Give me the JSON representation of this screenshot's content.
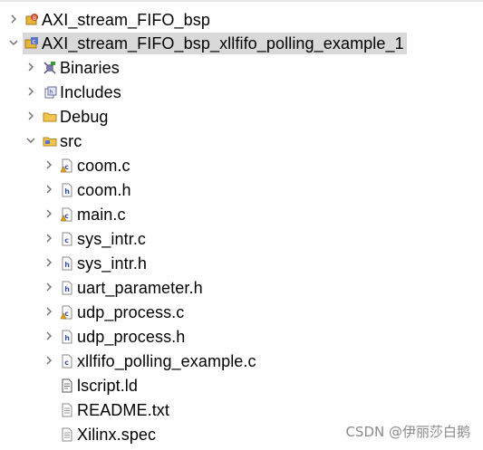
{
  "project_explorer": {
    "nodes": [
      {
        "label": "AXI_stream_FIFO_bsp",
        "icon": "bsp-project-icon",
        "expanded": false,
        "depth": 0,
        "selected": false
      },
      {
        "label": "AXI_stream_FIFO_bsp_xllfifo_polling_example_1",
        "icon": "c-project-icon",
        "expanded": true,
        "depth": 0,
        "selected": true
      },
      {
        "label": "Binaries",
        "icon": "binaries-icon",
        "expanded": false,
        "depth": 1,
        "selected": false
      },
      {
        "label": "Includes",
        "icon": "includes-icon",
        "expanded": false,
        "depth": 1,
        "selected": false
      },
      {
        "label": "Debug",
        "icon": "folder-icon",
        "expanded": false,
        "depth": 1,
        "selected": false
      },
      {
        "label": "src",
        "icon": "source-folder-icon",
        "expanded": true,
        "depth": 1,
        "selected": false
      },
      {
        "label": "coom.c",
        "icon": "c-file-warning-icon",
        "expanded": false,
        "depth": 2,
        "selected": false
      },
      {
        "label": "coom.h",
        "icon": "h-file-icon",
        "expanded": false,
        "depth": 2,
        "selected": false
      },
      {
        "label": "main.c",
        "icon": "c-file-warning-icon",
        "expanded": false,
        "depth": 2,
        "selected": false
      },
      {
        "label": "sys_intr.c",
        "icon": "c-file-icon",
        "expanded": false,
        "depth": 2,
        "selected": false
      },
      {
        "label": "sys_intr.h",
        "icon": "h-file-icon",
        "expanded": false,
        "depth": 2,
        "selected": false
      },
      {
        "label": "uart_parameter.h",
        "icon": "h-file-icon",
        "expanded": false,
        "depth": 2,
        "selected": false
      },
      {
        "label": "udp_process.c",
        "icon": "c-file-warning-icon",
        "expanded": false,
        "depth": 2,
        "selected": false
      },
      {
        "label": "udp_process.h",
        "icon": "h-file-icon",
        "expanded": false,
        "depth": 2,
        "selected": false
      },
      {
        "label": "xllfifo_polling_example.c",
        "icon": "c-file-icon",
        "expanded": false,
        "depth": 2,
        "selected": false
      },
      {
        "label": "lscript.ld",
        "icon": "ld-file-icon",
        "expanded": null,
        "depth": 2,
        "selected": false
      },
      {
        "label": "README.txt",
        "icon": "text-file-icon",
        "expanded": null,
        "depth": 2,
        "selected": false
      },
      {
        "label": "Xilinx.spec",
        "icon": "text-file-icon",
        "expanded": null,
        "depth": 2,
        "selected": false
      }
    ]
  },
  "watermark": "CSDN @伊丽莎白鹅",
  "colors": {
    "selection": "#d9d9d9",
    "twisty": "#6e6e6e",
    "folder": "#e8b53a",
    "c_badge": "#5a74c8",
    "warning": "#e0a020",
    "h_badge": "#5a6fa8"
  }
}
